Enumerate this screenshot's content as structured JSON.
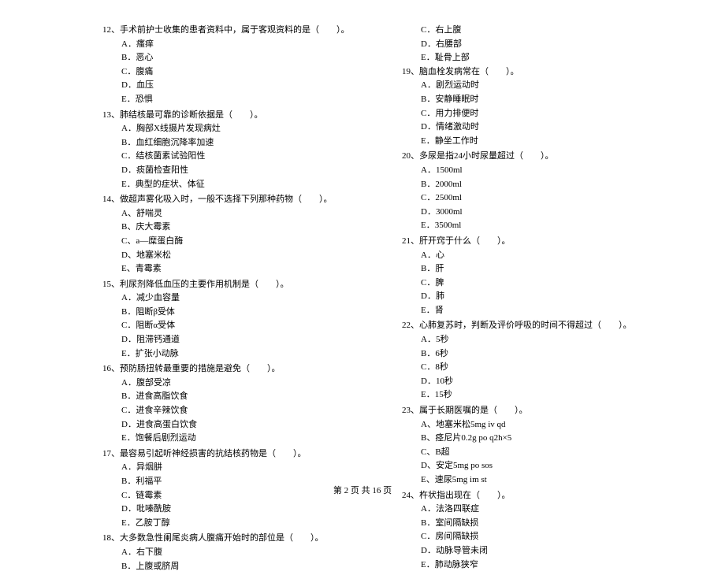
{
  "left": [
    {
      "num": "12、",
      "stem": "手术前护士收集的患者资料中，属于客观资料的是（　　）。",
      "opts": [
        "A．瘙痒",
        "B．恶心",
        "C．腹痛",
        "D．血压",
        "E．恐惧"
      ]
    },
    {
      "num": "13、",
      "stem": "肺结核最可靠的诊断依据是（　　）。",
      "opts": [
        "A．胸部X线摄片发现病灶",
        "B．血红细胞沉降率加速",
        "C．结核菌素试验阳性",
        "D．痰菌检查阳性",
        "E．典型的症状、体征"
      ]
    },
    {
      "num": "14、",
      "stem": "做超声雾化吸入时，一般不选择下列那种药物（　　）。",
      "opts": [
        "A、舒喘灵",
        "B、庆大霉素",
        "C、a—糜蛋白酶",
        "D、地塞米松",
        "E、青霉素"
      ]
    },
    {
      "num": "15、",
      "stem": "利尿剂降低血压的主要作用机制是（　　）。",
      "opts": [
        "A．减少血容量",
        "B．阻断β受体",
        "C．阻断α受体",
        "D．阻滞钙通道",
        "E．扩张小动脉"
      ]
    },
    {
      "num": "16、",
      "stem": "预防肠扭转最重要的措施是避免（　　）。",
      "opts": [
        "A．腹部受凉",
        "B．进食高脂饮食",
        "C．进食辛辣饮食",
        "D．进食高蛋白饮食",
        "E．饱餐后剧烈运动"
      ]
    },
    {
      "num": "17、",
      "stem": "最容易引起听神经损害的抗结核药物是（　　）。",
      "opts": [
        "A．异烟肼",
        "B．利福平",
        "C．链霉素",
        "D．吡嗪酰胺",
        "E．乙胺丁醇"
      ]
    },
    {
      "num": "18、",
      "stem": "大多数急性阑尾炎病人腹痛开始时的部位是（　　）。",
      "opts": [
        "A．右下腹",
        "B．上腹或脐周"
      ]
    }
  ],
  "right_pre_opts": [
    "C．右上腹",
    "D．右腰部",
    "E．耻骨上部"
  ],
  "right": [
    {
      "num": "19、",
      "stem": "脑血栓发病常在（　　）。",
      "opts": [
        "A．剧烈运动时",
        "B．安静睡眠时",
        "C．用力排便时",
        "D．情绪激动时",
        "E．静坐工作时"
      ]
    },
    {
      "num": "20、",
      "stem": "多尿是指24小时尿量超过（　　）。",
      "opts": [
        "A．1500ml",
        "B．2000ml",
        "C．2500ml",
        "D．3000ml",
        "E．3500ml"
      ]
    },
    {
      "num": "21、",
      "stem": "肝开窍于什么（　　）。",
      "opts": [
        "A．心",
        "B．肝",
        "C．脾",
        "D．肺",
        "E．肾"
      ]
    },
    {
      "num": "22、",
      "stem": "心肺复苏时，判断及评价呼吸的时间不得超过（　　）。",
      "opts": [
        "A．5秒",
        "B．6秒",
        "C．8秒",
        "D．10秒",
        "E．15秒"
      ]
    },
    {
      "num": "23、",
      "stem": "属于长期医嘱的是（　　）。",
      "opts": [
        "A、地塞米松5mg iv qd",
        "B、痉尼片0.2g po q2h×5",
        "C、B超",
        "D、安定5mg po sos",
        "E、速尿5mg im st"
      ]
    },
    {
      "num": "24、",
      "stem": "杵状指出现在（　　）。",
      "opts": [
        "A．法洛四联症",
        "B．室间隔缺损",
        "C．房间隔缺损",
        "D．动脉导管未闭",
        "E．肺动脉狭窄"
      ]
    }
  ],
  "footer": "第 2 页 共 16 页"
}
